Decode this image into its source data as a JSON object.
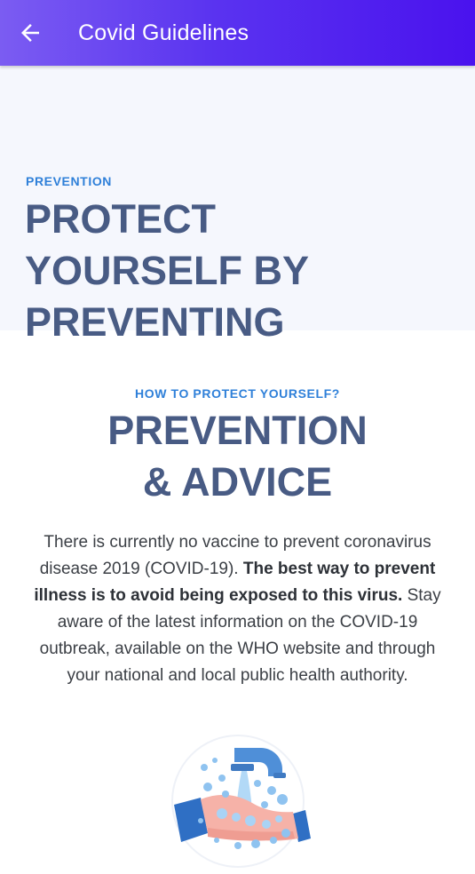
{
  "appbar": {
    "title": "Covid Guidelines"
  },
  "hero": {
    "kicker": "PREVENTION",
    "title": "PROTECT YOURSELF BY PREVENTING"
  },
  "section": {
    "kicker": "HOW TO PROTECT YOURSELF?",
    "title_line1": "PREVENTION",
    "title_line2": "& ADVICE",
    "body_part1": "There is currently no vaccine to prevent coronavirus disease 2019 (COVID-19). ",
    "body_bold": "The best way to prevent illness is to avoid being exposed to this virus.",
    "body_part2": " Stay aware of the latest information on the COVID-19 outbreak, available on the WHO website and through your national and local public health authority."
  },
  "colors": {
    "appbar_start": "#7b5cf2",
    "appbar_end": "#4a12ee",
    "accent_blue": "#2f80d9",
    "heading": "#485b84",
    "hero_bg": "#f5f7fd"
  },
  "icons": {
    "back": "arrow-left-icon",
    "illustration": "hand-washing-illustration"
  }
}
